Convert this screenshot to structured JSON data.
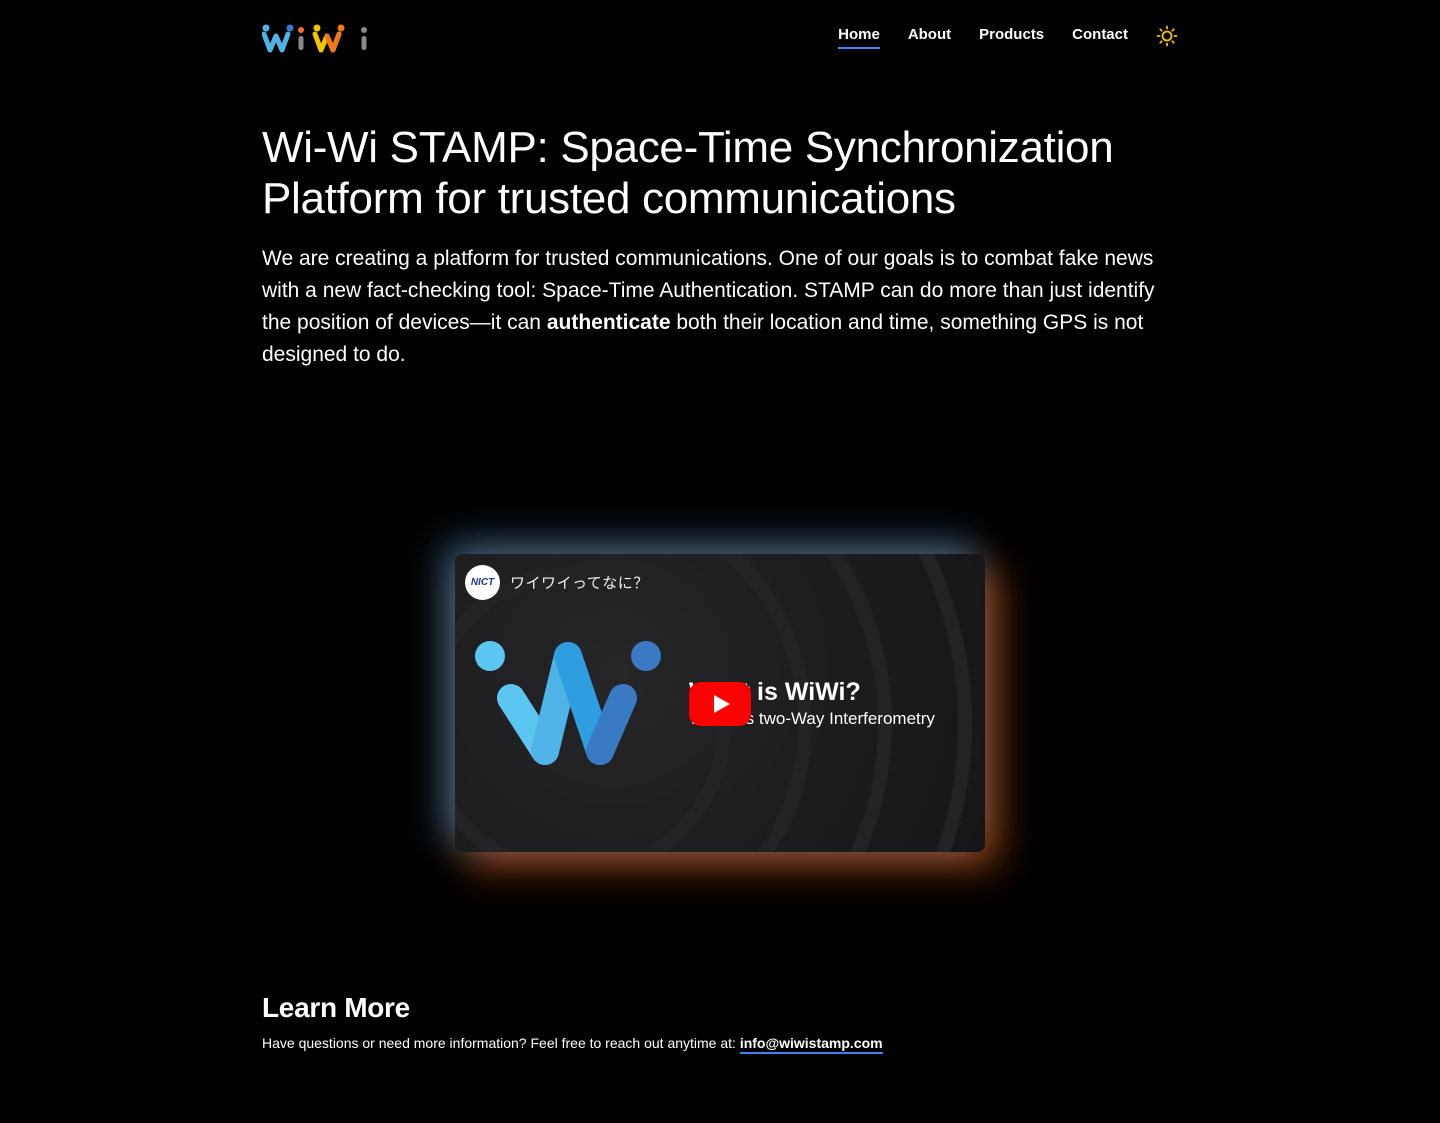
{
  "brand": {
    "logo_text": "WiWi",
    "colors": {
      "blue": "#4fb3e8",
      "yellow": "#f5c400",
      "orange": "#f07a1a",
      "gray": "#8a8a8a"
    }
  },
  "nav": {
    "items": [
      {
        "label": "Home",
        "active": true
      },
      {
        "label": "About",
        "active": false
      },
      {
        "label": "Products",
        "active": false
      },
      {
        "label": "Contact",
        "active": false
      }
    ],
    "theme_icon": "sun-icon",
    "accent": "#3b82f6"
  },
  "hero": {
    "title": "Wi-Wi STAMP: Space-Time Synchronization Platform for trusted communications",
    "intro_before": "We are creating a platform for trusted communications. One of our goals is to combat fake news with a new fact-checking tool: Space-Time Authentication. STAMP can do more than just identify the position of devices—it can ",
    "intro_bold": "authenticate",
    "intro_after": " both their location and time, something GPS is not designed to do."
  },
  "video": {
    "channel": "NICT",
    "title": "ワイワイってなに？",
    "heading": "What is WiWi?",
    "subheading": "Wireless two-Way Interferometry",
    "play_icon": "youtube-play-icon"
  },
  "learn_more": {
    "heading": "Learn More",
    "text": "Have questions or need more information? Feel free to reach out anytime at: ",
    "email": "info@wiwistamp.com"
  }
}
